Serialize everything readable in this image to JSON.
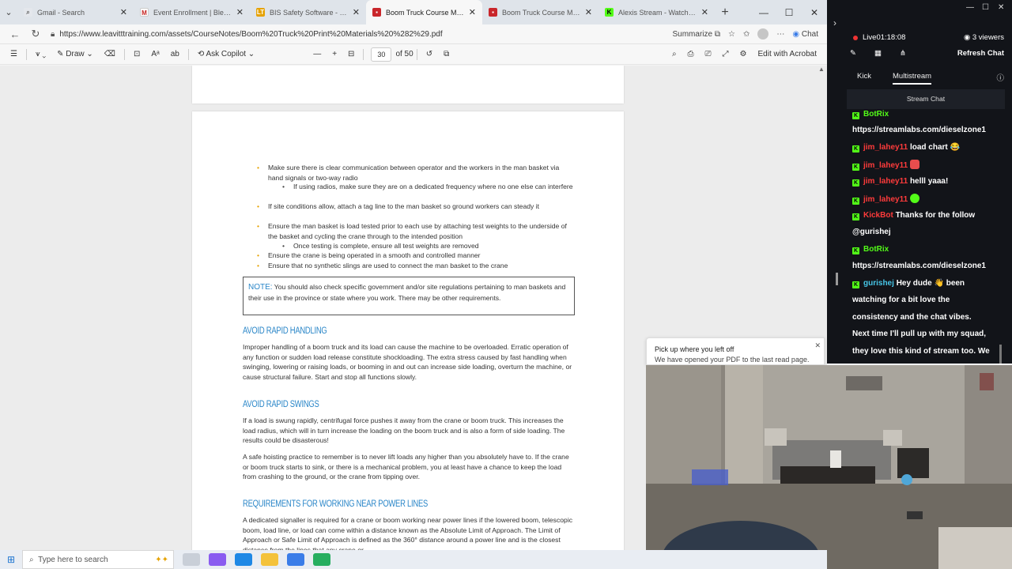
{
  "browser": {
    "tabs": [
      {
        "label": "Gmail - Search",
        "active": false
      },
      {
        "label": "Event Enrollment | Blended O",
        "active": false
      },
      {
        "label": "BIS Safety Software - Boom Tr",
        "active": false
      },
      {
        "label": "Boom Truck Course Materials",
        "active": true
      },
      {
        "label": "Boom Truck Course Materials",
        "active": false
      },
      {
        "label": "Alexis Stream - Watch Live",
        "active": false
      }
    ],
    "url": "https://www.leavitttraining.com/assets/CourseNotes/Boom%20Truck%20Print%20Materials%20%282%29.pdf",
    "summarize_label": "Summarize",
    "chat_label": "Chat"
  },
  "pdf_toolbar": {
    "draw_label": "Draw",
    "ask_copilot_label": "Ask Copilot",
    "page_number": "30",
    "page_total": "of 50",
    "edit_acrobat_label": "Edit with Acrobat"
  },
  "document": {
    "bullets": [
      {
        "kind": "bullet",
        "text": "Make sure there is clear communication between operator and the workers in the man basket via hand signals or two-way radio"
      },
      {
        "kind": "sub",
        "text": "If using radios, make sure they are on a dedicated frequency where no one else can interfere"
      },
      {
        "kind": "bullet",
        "text": "If site conditions allow, attach a tag line to the man basket so ground workers can steady it"
      },
      {
        "kind": "bullet",
        "text": "Ensure the man basket is load tested prior to each use by attaching test weights to the underside of the basket and cycling the crane through to the intended position"
      },
      {
        "kind": "sub",
        "text": "Once testing is complete, ensure all test weights are removed"
      },
      {
        "kind": "bullet",
        "text": "Ensure the crane is being operated in a smooth and controlled manner"
      },
      {
        "kind": "bullet",
        "text": "Ensure that no synthetic slings are used to connect the man basket to the crane"
      }
    ],
    "note_label": "NOTE:",
    "note_text": "You should also check specific government and/or site regulations pertaining to man baskets and their use in the province or state where you work. There may be other requirements.",
    "h_rapid_handling": "AVOID RAPID HANDLING",
    "p_rapid_handling": "Improper handling of a boom truck and its load can cause the machine to be overloaded. Erratic operation of any function or sudden load release constitute shockloading. The extra stress caused by fast handling when swinging, lowering or raising loads, or booming in and out can increase side loading, overturn the machine, or cause structural failure. Start and stop all functions slowly.",
    "h_rapid_swings": "AVOID RAPID SWINGS",
    "p_rapid_swings": "If a load is swung rapidly, centrifugal force pushes it away from the crane or boom truck. This increases the load radius, which will in turn increase the loading on the boom truck and is also a form of side loading. The results could be disasterous!",
    "p_hoisting": "A safe hoisting practice to remember is to never lift loads any higher than you absolutely have to. If the crane or boom truck starts to sink, or there is a mechanical problem, you at least have a chance to keep the load from crashing to the ground, or the crane from tipping over.",
    "h_power_lines": "REQUIREMENTS FOR WORKING NEAR POWER LINES",
    "p_power_lines": "A dedicated signaller is required for a crane or boom working near power lines if the lowered boom, telescopic boom, load line, or load can come within a distance known as the Absolute Limit of Approach. The Limit of Approach or Safe Limit of Approach is defined as the 360° distance around a power line and is the closest distance from the lines that any crane or"
  },
  "toast": {
    "title": "Pick up where you left off",
    "body": "We have opened your PDF to the last read page."
  },
  "stream": {
    "live_label": "Live",
    "live_time": "01:18:08",
    "viewers": "3 viewers",
    "refresh_label": "Refresh Chat",
    "tabs": [
      "Kick",
      "Multistream"
    ],
    "stream_chat_label": "Stream Chat",
    "messages": [
      {
        "user": "BotRix",
        "color": "green",
        "text": ""
      },
      {
        "user": "",
        "color": "",
        "text": "https://streamlabs.com/dieselzone1"
      },
      {
        "user": "jim_lahey11",
        "color": "red",
        "text": "load chart 😂"
      },
      {
        "user": "jim_lahey11",
        "color": "red",
        "text": ""
      },
      {
        "user": "jim_lahey11",
        "color": "red",
        "text": "helll yaaa!"
      },
      {
        "user": "jim_lahey11",
        "color": "red",
        "text": ""
      },
      {
        "user": "KickBot",
        "color": "red",
        "text": "Thanks for the follow"
      },
      {
        "user": "",
        "color": "",
        "text": "@gurishej"
      },
      {
        "user": "BotRix",
        "color": "green",
        "text": ""
      },
      {
        "user": "",
        "color": "",
        "text": "https://streamlabs.com/dieselzone1"
      },
      {
        "user": "gurishej",
        "color": "cyan",
        "text": "Hey dude 👋 been"
      },
      {
        "user": "",
        "color": "",
        "text": "watching for a bit love the"
      },
      {
        "user": "",
        "color": "",
        "text": "consistency and the chat vibes."
      },
      {
        "user": "",
        "color": "",
        "text": "Next time I'll pull up with my squad,"
      },
      {
        "user": "",
        "color": "",
        "text": "they love this kind of stream too. We"
      }
    ]
  },
  "taskbar": {
    "search_placeholder": "Type here to search"
  }
}
